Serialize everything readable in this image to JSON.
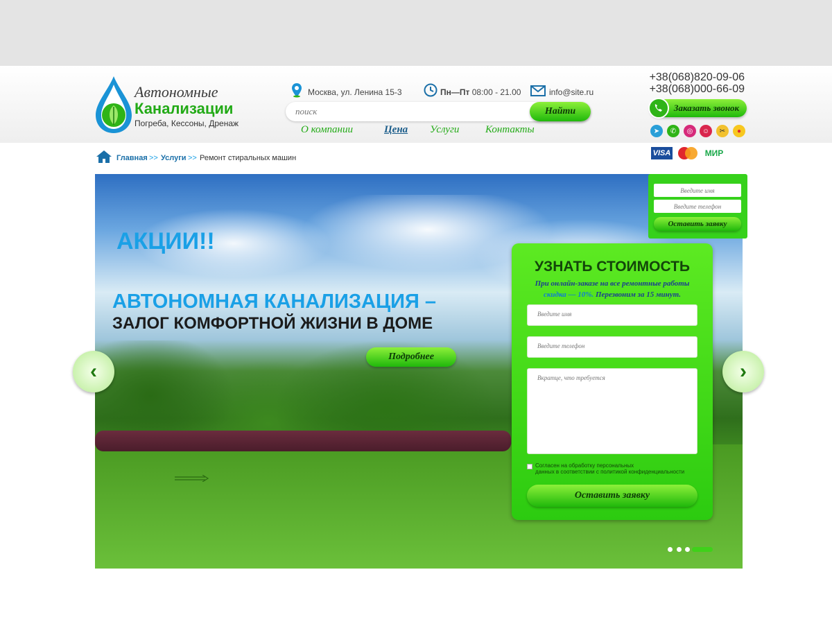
{
  "logo": {
    "line1": "Автономные",
    "line2": "Канализации",
    "line3": "Погреба, Кессоны, Дренаж",
    "icon": "drop-leaf-logo"
  },
  "contacts": {
    "address": "Москва, ул. Ленина 15-3",
    "hours_days": "Пн—Пт",
    "hours_time": "08:00 - 21.00",
    "email": "info@site.ru",
    "phones": [
      "+38(068)820-09-06",
      "+38(068)000-66-09"
    ],
    "callback_label": "Заказать звонок"
  },
  "search": {
    "placeholder": "поиск",
    "button": "Найти"
  },
  "nav": [
    {
      "label": "О компании"
    },
    {
      "label": "Цена"
    },
    {
      "label": "Услуги"
    },
    {
      "label": "Контакты"
    }
  ],
  "social_icons": [
    "telegram-icon",
    "whatsapp-icon",
    "instagram-icon",
    "odnoklassniki-icon",
    "yandex-icon",
    "avito-icon"
  ],
  "payments": {
    "visa": "VISA",
    "mastercard": "MasterCard",
    "mir": "МИР"
  },
  "breadcrumb": {
    "home": "Главная",
    "sep": ">>",
    "services": "Услуги",
    "current": "Ремонт стиральных машин"
  },
  "hero": {
    "promo": "АКЦИИ!!",
    "title1": "АВТОНОМНАЯ КАНАЛИЗАЦИЯ –",
    "title2": "ЗАЛОГ КОМФОРТНОЙ ЖИЗНИ В ДОМЕ",
    "more_button": "Подробнее",
    "slides_total": 4,
    "active_slide": 4
  },
  "mini_form": {
    "name_placeholder": "Введите имя",
    "phone_placeholder": "Введите  телефон",
    "submit": "Оставить заявку"
  },
  "price_form": {
    "title": "УЗНАТЬ СТОИМОСТЬ",
    "subtitle_start": "При онлайн-заказе на все ремонтные работы",
    "subtitle_discount": "скидка — 10%.",
    "subtitle_end": "Перезвоним за 15 минут.",
    "name_placeholder": "Введите имя",
    "phone_placeholder": "Введите телефон",
    "message_placeholder": "Вкратце, что требуется",
    "consent_line1": "Согласен на обработку персональных",
    "consent_line2": "данных в соответствии с политикой конфиденциальности",
    "submit": "Оставить заявку"
  },
  "colors": {
    "accent_green": "#22aa16",
    "accent_blue": "#1aa0e6",
    "nav_active": "#1a5c8a"
  }
}
